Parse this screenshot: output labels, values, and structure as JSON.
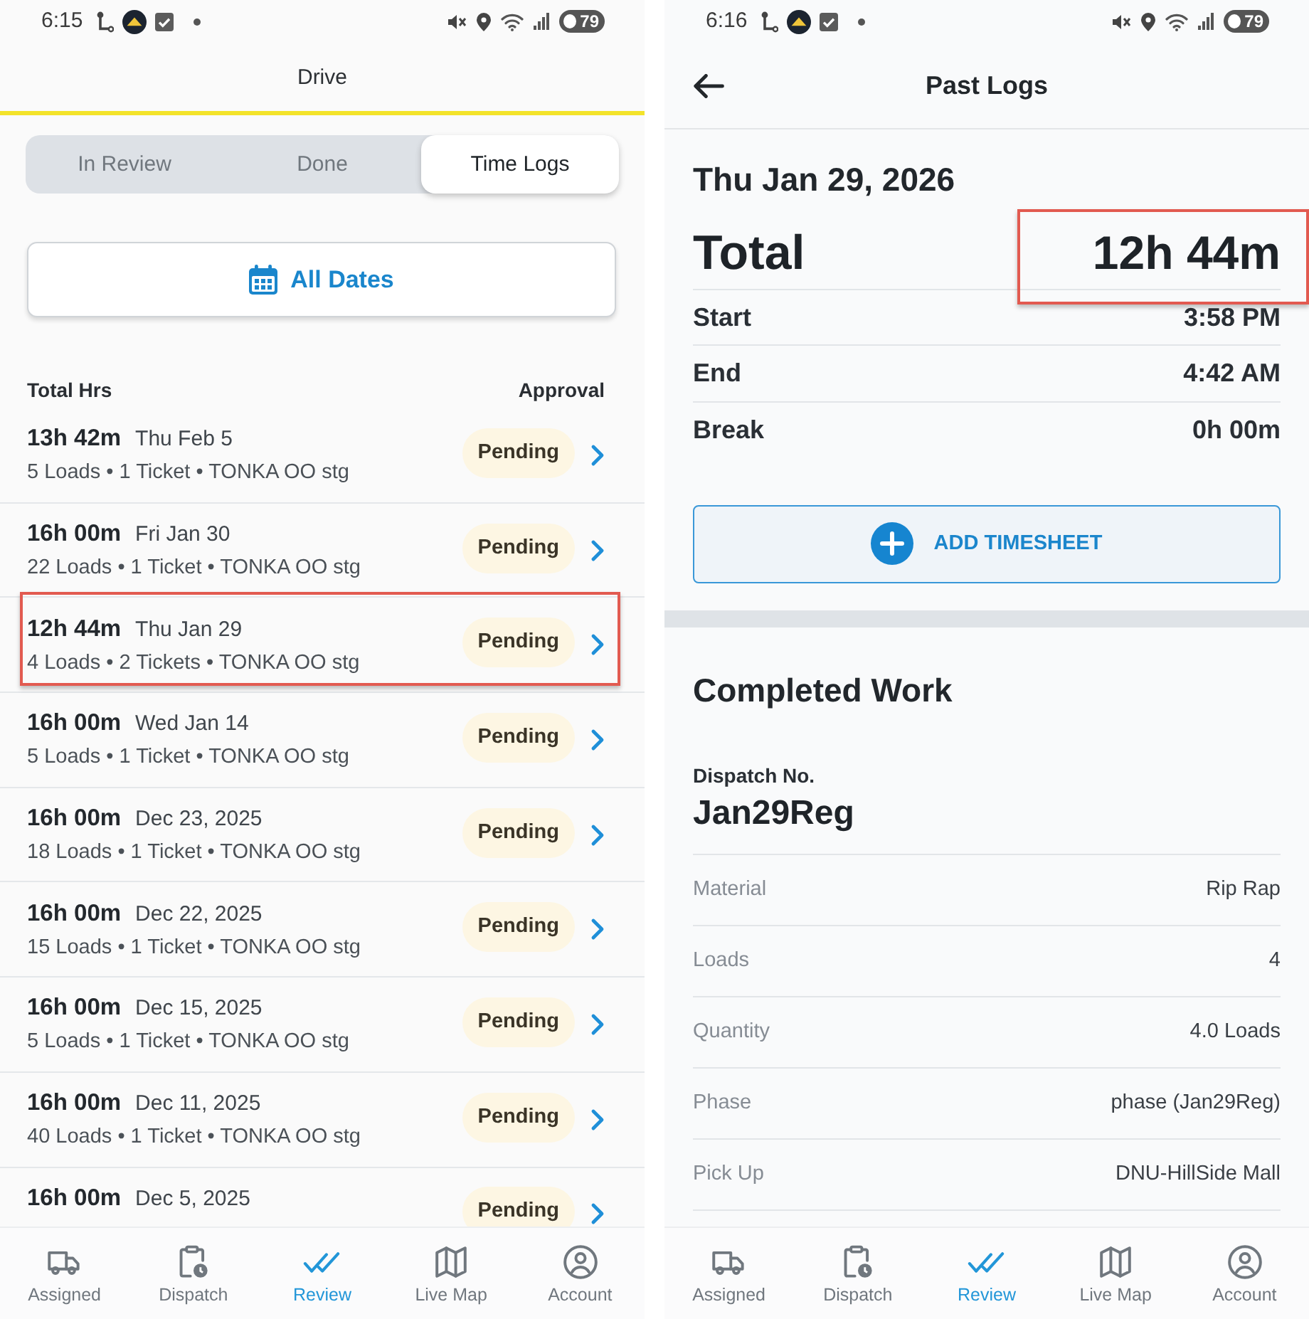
{
  "list_screen": {
    "status_bar": {
      "time": "6:15",
      "battery": "79"
    },
    "title": "Drive",
    "tabs": [
      {
        "label": "In Review",
        "selected": false
      },
      {
        "label": "Done",
        "selected": false
      },
      {
        "label": "Time Logs",
        "selected": true
      }
    ],
    "date_filter": {
      "label": "All Dates"
    },
    "list_header": {
      "total_column": "Total Hrs",
      "approval_column": "Approval"
    },
    "logs": [
      {
        "total": "13h 42m",
        "date": "Thu Feb 5",
        "summary": "5 Loads • 1 Ticket • TONKA OO stg",
        "status": "Pending",
        "highlighted": false
      },
      {
        "total": "16h 00m",
        "date": "Fri Jan 30",
        "summary": "22 Loads • 1 Ticket • TONKA OO stg",
        "status": "Pending",
        "highlighted": false
      },
      {
        "total": "12h 44m",
        "date": "Thu Jan 29",
        "summary": "4 Loads • 2 Tickets • TONKA OO stg",
        "status": "Pending",
        "highlighted": true
      },
      {
        "total": "16h 00m",
        "date": "Wed Jan 14",
        "summary": "5 Loads • 1 Ticket • TONKA OO stg",
        "status": "Pending",
        "highlighted": false
      },
      {
        "total": "16h 00m",
        "date": "Dec 23, 2025",
        "summary": "18 Loads • 1 Ticket • TONKA OO stg",
        "status": "Pending",
        "highlighted": false
      },
      {
        "total": "16h 00m",
        "date": "Dec 22, 2025",
        "summary": "15 Loads • 1 Ticket • TONKA OO stg",
        "status": "Pending",
        "highlighted": false
      },
      {
        "total": "16h 00m",
        "date": "Dec 15, 2025",
        "summary": "5 Loads • 1 Ticket • TONKA OO stg",
        "status": "Pending",
        "highlighted": false
      },
      {
        "total": "16h 00m",
        "date": "Dec 11, 2025",
        "summary": "40 Loads • 1 Ticket • TONKA OO stg",
        "status": "Pending",
        "highlighted": false
      },
      {
        "total": "16h 00m",
        "date": "Dec 5, 2025",
        "status": "Pending",
        "highlighted": false
      }
    ],
    "bottom_nav": [
      {
        "label": "Assigned",
        "selected": false
      },
      {
        "label": "Dispatch",
        "selected": false
      },
      {
        "label": "Review",
        "selected": true
      },
      {
        "label": "Live Map",
        "selected": false
      },
      {
        "label": "Account",
        "selected": false
      }
    ]
  },
  "detail_screen": {
    "status_bar": {
      "time": "6:16",
      "battery": "79"
    },
    "title": "Past Logs",
    "date": "Thu Jan 29, 2026",
    "total": {
      "label": "Total",
      "value": "12h 44m",
      "highlighted": true
    },
    "times": [
      {
        "label": "Start",
        "value": "3:58 PM"
      },
      {
        "label": "End",
        "value": "4:42 AM"
      },
      {
        "label": "Break",
        "value": "0h 00m"
      }
    ],
    "add_button": {
      "label": "ADD TIMESHEET"
    },
    "section_title": "Completed Work",
    "dispatch": {
      "label": "Dispatch No.",
      "value": "Jan29Reg"
    },
    "details": [
      {
        "label": "Material",
        "value": "Rip Rap"
      },
      {
        "label": "Loads",
        "value": "4"
      },
      {
        "label": "Quantity",
        "value": "4.0 Loads"
      },
      {
        "label": "Phase",
        "value": "phase (Jan29Reg)"
      },
      {
        "label": "Pick Up",
        "value": "DNU-HillSide Mall"
      }
    ],
    "bottom_nav": [
      {
        "label": "Assigned",
        "selected": false
      },
      {
        "label": "Dispatch",
        "selected": false
      },
      {
        "label": "Review",
        "selected": true
      },
      {
        "label": "Live Map",
        "selected": false
      },
      {
        "label": "Account",
        "selected": false
      }
    ]
  }
}
